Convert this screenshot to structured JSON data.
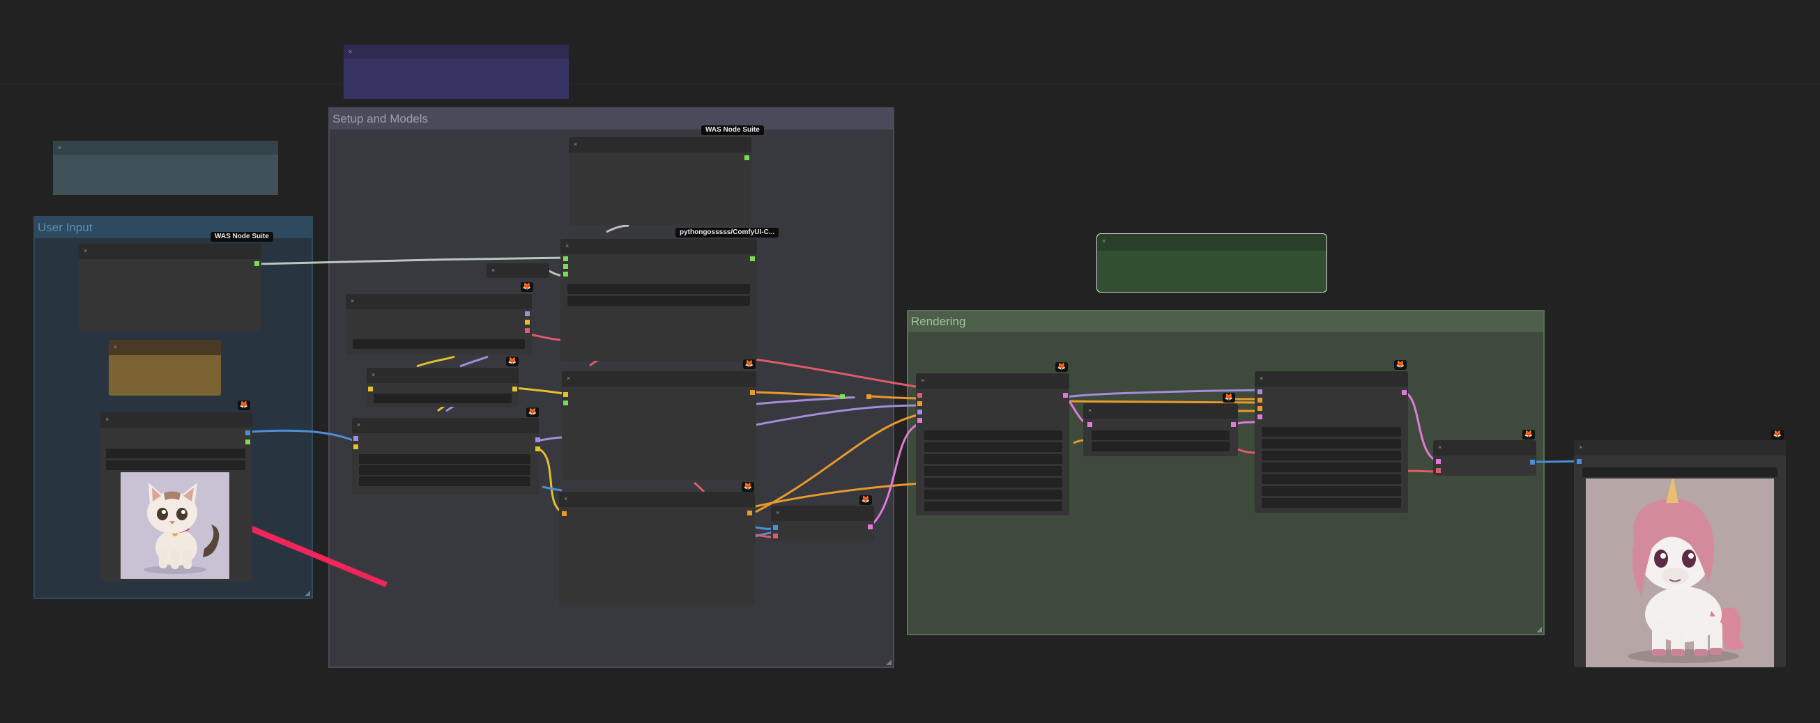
{
  "groups": {
    "user_input": {
      "title": "User Input"
    },
    "setup_models": {
      "title": "Setup and Models"
    },
    "rendering": {
      "title": "Rendering"
    }
  },
  "badges": {
    "was_1": "WAS Node Suite",
    "was_2": "WAS Node Suite",
    "pythongosssss": "pythongosssss/ComfyUI-C..."
  },
  "icons": {
    "collapse": "×",
    "fox": "🦊"
  },
  "images": {
    "input": "kitten-illustration",
    "output": "unicorn-pony-illustration"
  },
  "colors": {
    "background": "#222222",
    "node": "#353535",
    "arrow": "#f0265a",
    "link_green": "#7ed957",
    "link_blue": "#4c8fd9",
    "link_yellow": "#e5c12a",
    "link_orange": "#e89a2a",
    "link_purple": "#a48dd9",
    "link_red": "#e05a6a",
    "link_pink": "#e07ad9"
  }
}
